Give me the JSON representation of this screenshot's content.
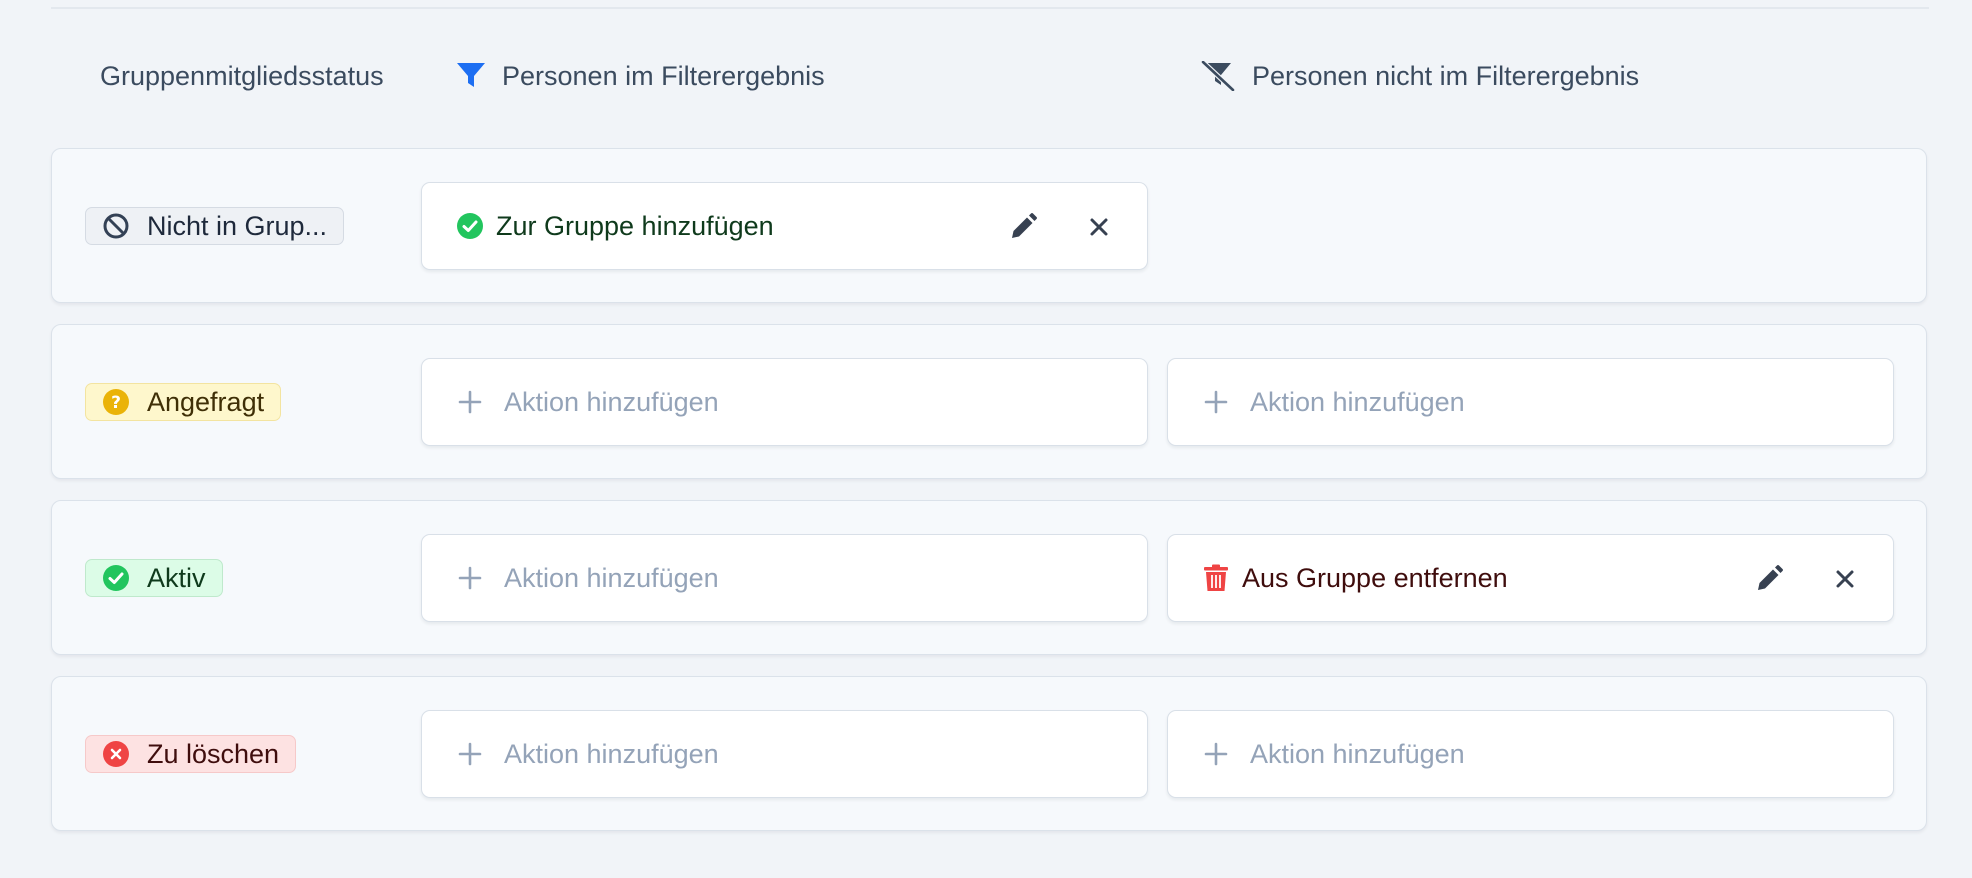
{
  "header": {
    "status_label": "Gruppenmitgliedsstatus",
    "in_filter_label": "Personen im Filterergebnis",
    "not_in_filter_label": "Personen nicht im Filterergebnis"
  },
  "rows": [
    {
      "status": "Nicht in Grup...",
      "status_icon": "ban-icon",
      "in_filter_action": "Zur Gruppe hinzufügen",
      "in_filter_icon": "check-circle-icon"
    },
    {
      "status": "Angefragt",
      "status_icon": "question-circle-icon",
      "in_filter_action": "Aktion hinzufügen",
      "not_in_filter_action": "Aktion hinzufügen"
    },
    {
      "status": "Aktiv",
      "status_icon": "check-circle-icon",
      "in_filter_action": "Aktion hinzufügen",
      "not_in_filter_action": "Aus Gruppe entfernen",
      "not_in_filter_icon": "trash-icon"
    },
    {
      "status": "Zu löschen",
      "status_icon": "x-circle-icon",
      "in_filter_action": "Aktion hinzufügen",
      "not_in_filter_action": "Aktion hinzufügen"
    }
  ],
  "colors": {
    "filter_blue": "#1d6ef2",
    "success_green": "#22c55e",
    "warning_yellow": "#eab308",
    "danger_red": "#ef4444",
    "muted_text": "#94a3b8"
  }
}
